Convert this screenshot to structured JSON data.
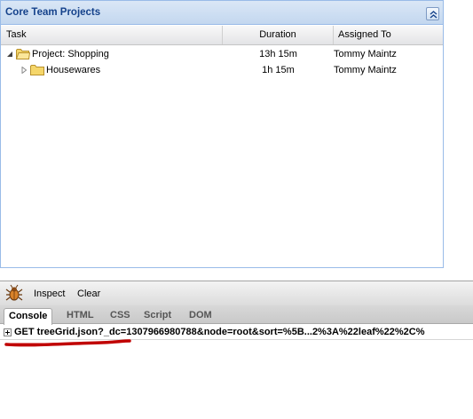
{
  "panel": {
    "title": "Core Team Projects"
  },
  "grid": {
    "columns": {
      "task": "Task",
      "duration": "Duration",
      "assigned": "Assigned To"
    },
    "rows": [
      {
        "task": "Project: Shopping",
        "duration": "13h 15m",
        "assigned": "Tommy Maintz",
        "expanded": true
      },
      {
        "task": "Housewares",
        "duration": "1h 15m",
        "assigned": "Tommy Maintz",
        "expanded": false
      }
    ]
  },
  "firebug": {
    "toolbar": {
      "inspect": "Inspect",
      "clear": "Clear"
    },
    "tabs": [
      "Console",
      "HTML",
      "CSS",
      "Script",
      "DOM"
    ],
    "active_tab": "Console",
    "log_entry": "GET treeGrid.json?_dc=1307966980788&node=root&sort=%5B...2%3A%22leaf%22%2C%"
  },
  "colors": {
    "panel_border": "#99bbe8",
    "title_text": "#15428b",
    "annotation_red": "#c00000",
    "folder_yellow": "#f5d66a"
  }
}
